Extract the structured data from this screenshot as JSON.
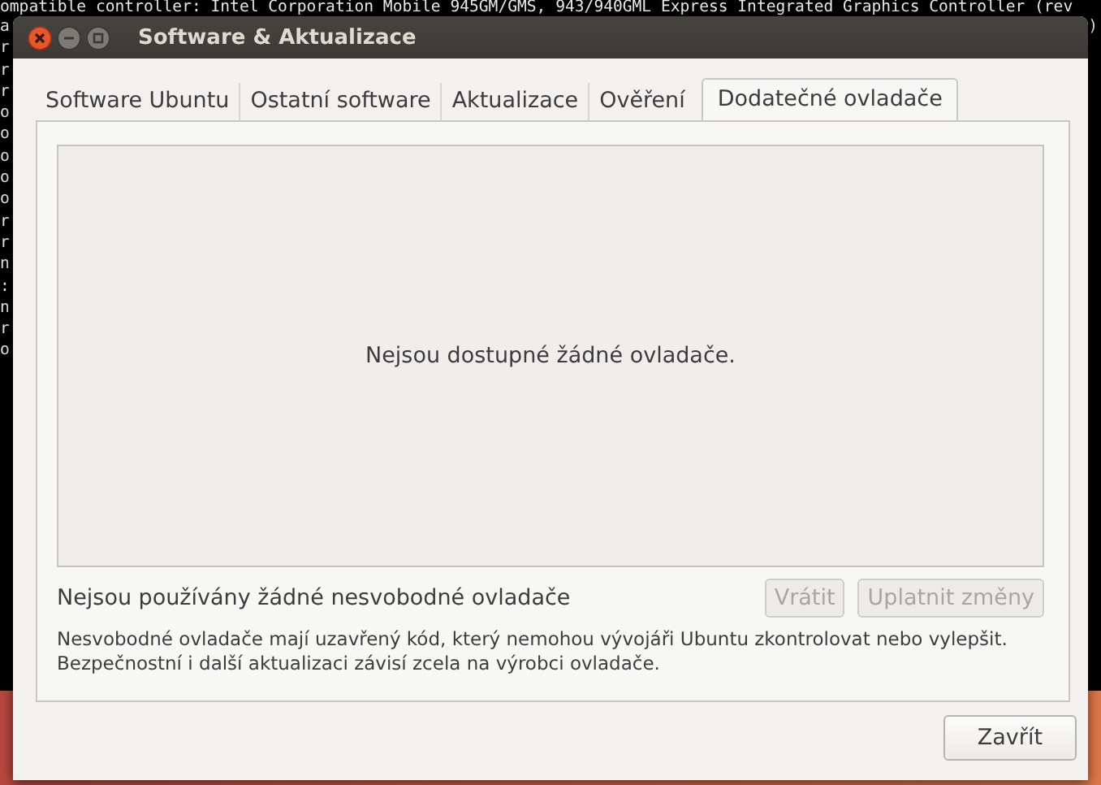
{
  "terminal": {
    "lines": [
      {
        "text": "ompatible controller: Intel Corporation Mobile 945GM/GMS, 943/940GML Express Integrated Graphics Controller (rev"
      },
      {
        "text": "a",
        "right": ")"
      },
      {
        "text": "r"
      },
      {
        "text": "r"
      },
      {
        "text": "r"
      },
      {
        "text": "o"
      },
      {
        "text": "o"
      },
      {
        "text": "o"
      },
      {
        "text": "o"
      },
      {
        "text": "o"
      },
      {
        "text": "r"
      },
      {
        "text": "r"
      },
      {
        "text": "n"
      },
      {
        "text": ":"
      },
      {
        "text": "n"
      },
      {
        "text": "r"
      },
      {
        "text": "o"
      }
    ]
  },
  "window": {
    "title": "Software & Aktualizace"
  },
  "tabs": [
    {
      "label": "Software Ubuntu",
      "selected": false
    },
    {
      "label": "Ostatní software",
      "selected": false
    },
    {
      "label": "Aktualizace",
      "selected": false
    },
    {
      "label": "Ověření",
      "selected": false
    },
    {
      "label": "Dodatečné ovladače",
      "selected": true
    }
  ],
  "drivers_list": {
    "empty_message": "Nejsou dostupné žádné ovladače."
  },
  "status": "Nejsou používány žádné nesvobodné ovladače",
  "buttons": [
    {
      "label": "Vrátit",
      "disabled": true
    },
    {
      "label": "Uplatnit změny",
      "disabled": true
    }
  ],
  "note": "Nesvobodné ovladače mají uzavřený kód, který nemohou vývojáři Ubuntu zkontrolovat nebo vylepšit. Bezpečnostní i další aktualizaci závisí zcela na výrobci ovladače.",
  "close_button": {
    "label": "Zavřít"
  }
}
